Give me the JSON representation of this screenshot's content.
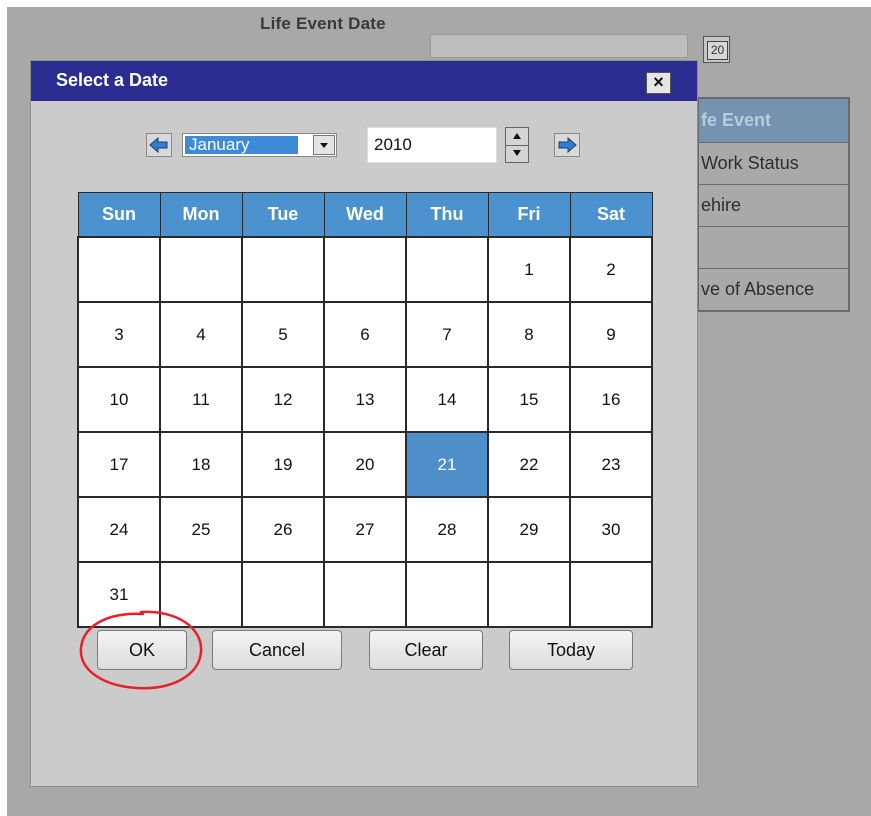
{
  "background": {
    "field_label": "Life Event Date",
    "calendar_icon_text": "20",
    "table": {
      "header": "fe Event",
      "rows": [
        "Work Status",
        "ehire",
        "",
        "ve of Absence"
      ]
    }
  },
  "dialog": {
    "title": "Select a Date",
    "close_label": "×",
    "month": {
      "selected": "January"
    },
    "year": {
      "value": "2010"
    },
    "calendar": {
      "weekdays": [
        "Sun",
        "Mon",
        "Tue",
        "Wed",
        "Thu",
        "Fri",
        "Sat"
      ],
      "weeks": [
        [
          "",
          "",
          "",
          "",
          "",
          "1",
          "2"
        ],
        [
          "3",
          "4",
          "5",
          "6",
          "7",
          "8",
          "9"
        ],
        [
          "10",
          "11",
          "12",
          "13",
          "14",
          "15",
          "16"
        ],
        [
          "17",
          "18",
          "19",
          "20",
          "21",
          "22",
          "23"
        ],
        [
          "24",
          "25",
          "26",
          "27",
          "28",
          "29",
          "30"
        ],
        [
          "31",
          "",
          "",
          "",
          "",
          "",
          ""
        ]
      ],
      "selected_day": "21"
    },
    "buttons": {
      "ok": "OK",
      "cancel": "Cancel",
      "clear": "Clear",
      "today": "Today"
    },
    "annotation": {
      "color": "#e8202a",
      "target": "ok"
    }
  },
  "colors": {
    "title_bar": "#2b2c90",
    "header_row": "#4b92cf",
    "selected_day": "#4f8fc9",
    "month_highlight": "#3d8ad7"
  }
}
